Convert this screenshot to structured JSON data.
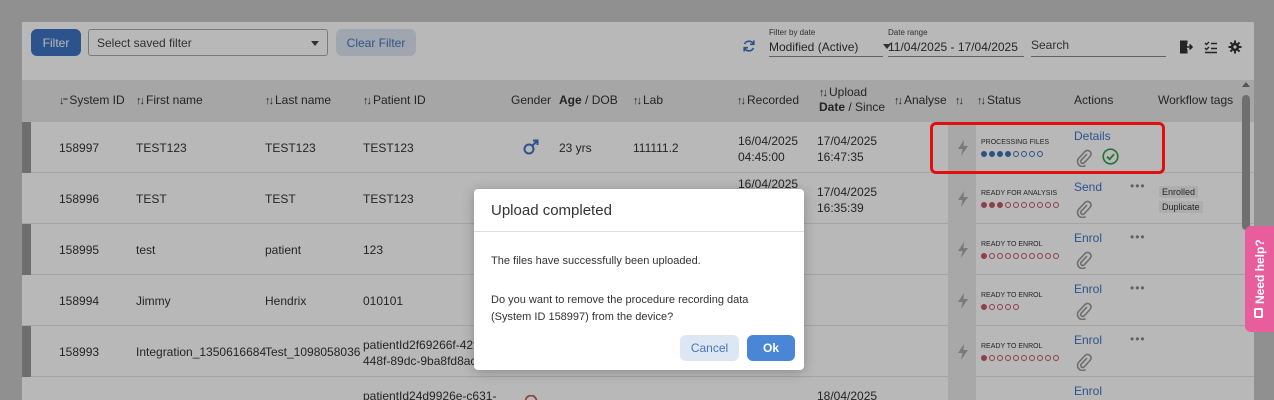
{
  "toolbar": {
    "filter_label": "Filter",
    "saved_filter_placeholder": "Select saved filter",
    "clear_filter_label": "Clear Filter",
    "filter_by_date_label": "Filter by date",
    "filter_by_date_value": "Modified (Active)",
    "date_range_label": "Date range",
    "date_range_value": "11/04/2025 - 17/04/2025",
    "search_placeholder": "Search"
  },
  "table": {
    "headers": {
      "system_id": "System ID",
      "first_name": "First name",
      "last_name": "Last name",
      "patient_id": "Patient ID",
      "gender": "Gender",
      "age": "Age",
      "dob": "DOB",
      "lab": "Lab",
      "recorded": "Recorded",
      "upload": "Upload",
      "date": "Date",
      "since": "Since",
      "analyse": "Analyse",
      "status": "Status",
      "actions": "Actions",
      "workflow_tags": "Workflow tags"
    },
    "rows": [
      {
        "system_id": "158997",
        "first_name": "TEST123",
        "last_name": "TEST123",
        "patient_id": "TEST123",
        "age": "23 yrs",
        "lab": "111111.2",
        "recorded_date": "16/04/2025",
        "recorded_time": "04:45:00",
        "upload_date": "17/04/2025",
        "upload_time": "16:47:35",
        "status": "PROCESSING FILES",
        "action": "Details"
      },
      {
        "system_id": "158996",
        "first_name": "TEST",
        "last_name": "TEST",
        "patient_id": "TEST123",
        "recorded_date": "16/04/2025",
        "upload_date": "17/04/2025",
        "upload_time": "16:35:39",
        "status": "READY FOR ANALYSIS",
        "action": "Send",
        "tags": [
          "Enrolled",
          "Duplicate"
        ]
      },
      {
        "system_id": "158995",
        "first_name": "test",
        "last_name": "patient",
        "patient_id": "123",
        "status": "READY TO ENROL",
        "action": "Enrol"
      },
      {
        "system_id": "158994",
        "first_name": "Jimmy",
        "last_name": "Hendrix",
        "patient_id": "010101",
        "status": "READY TO ENROL",
        "action": "Enrol"
      },
      {
        "system_id": "158993",
        "first_name": "Integration_1350616684",
        "last_name": "Test_1098058036",
        "patient_id_line1": "patientId2f69266f-42f",
        "patient_id_line2": "448f-89dc-9ba8fd8ac",
        "status": "READY TO ENROL",
        "action": "Enrol"
      },
      {
        "patient_id": "patientId24d9926e-c631-",
        "upload_date": "18/04/2025",
        "action": "Enrol"
      }
    ]
  },
  "help_label": "Need help?",
  "modal": {
    "title": "Upload completed",
    "message": "The files have successfully been uploaded.",
    "question": "Do you want to remove the procedure recording data (System ID 158997) from the device?",
    "cancel_label": "Cancel",
    "ok_label": "Ok"
  },
  "colors": {
    "primary": "#3f73c4",
    "highlight": "#e01010",
    "help": "#e85d9b",
    "dot_blue": "#3f6fb8",
    "dot_red": "#c25a64"
  }
}
